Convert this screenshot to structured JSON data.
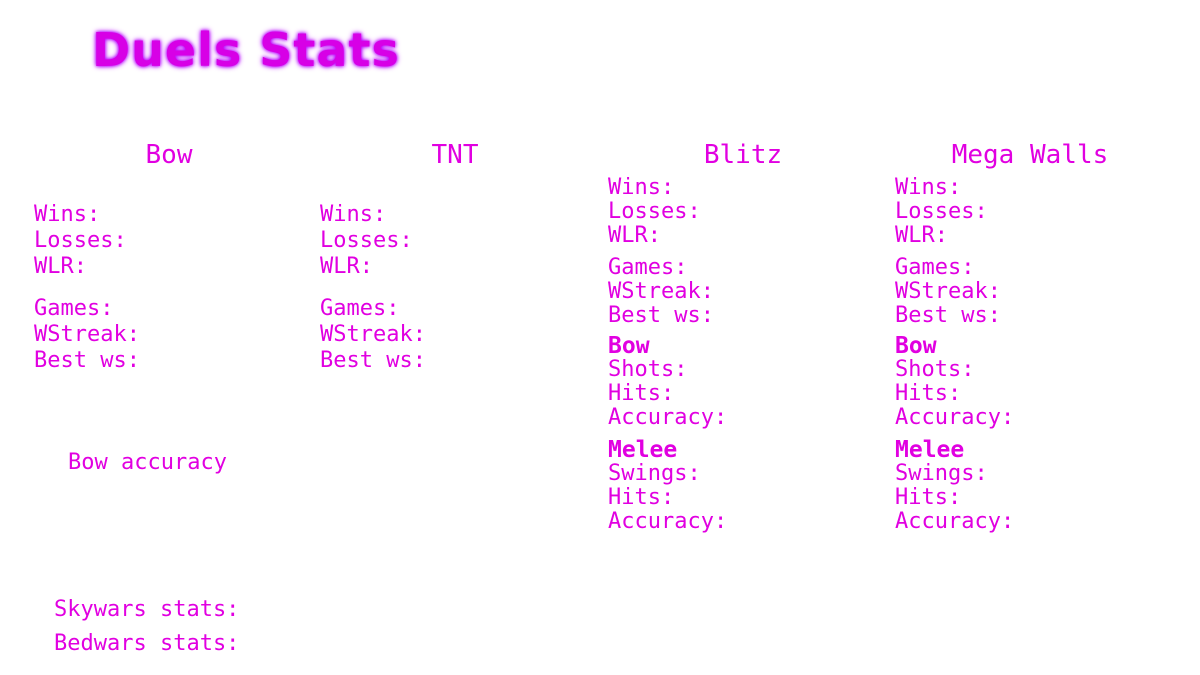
{
  "title": "Duels Stats",
  "colors": {
    "text": "#e100e1",
    "title": "#d700e6"
  },
  "columns": {
    "bow": {
      "heading": "Bow",
      "wins": "Wins:",
      "losses": "Losses:",
      "wlr": "WLR:",
      "games": "Games:",
      "wstreak": "WStreak:",
      "best_ws": "Best ws:"
    },
    "tnt": {
      "heading": "TNT",
      "wins": "Wins:",
      "losses": "Losses:",
      "wlr": "WLR:",
      "games": "Games:",
      "wstreak": "WStreak:",
      "best_ws": "Best ws:"
    },
    "blitz": {
      "heading": "Blitz",
      "wins": "Wins:",
      "losses": "Losses:",
      "wlr": "WLR:",
      "games": "Games:",
      "wstreak": "WStreak:",
      "best_ws": "Best ws:",
      "bow_heading": "Bow",
      "shots": "Shots:",
      "bow_hits": "Hits:",
      "bow_accuracy": "Accuracy:",
      "melee_heading": "Melee",
      "swings": "Swings:",
      "melee_hits": "Hits:",
      "melee_accuracy": "Accuracy:"
    },
    "megawalls": {
      "heading": "Mega Walls",
      "wins": "Wins:",
      "losses": "Losses:",
      "wlr": "WLR:",
      "games": "Games:",
      "wstreak": "WStreak:",
      "best_ws": "Best ws:",
      "bow_heading": "Bow",
      "shots": "Shots:",
      "bow_hits": "Hits:",
      "bow_accuracy": "Accuracy:",
      "melee_heading": "Melee",
      "swings": "Swings:",
      "melee_hits": "Hits:",
      "melee_accuracy": "Accuracy:"
    }
  },
  "bow_accuracy_label": "Bow accuracy",
  "skywars_label": "Skywars stats:",
  "bedwars_label": "Bedwars stats:"
}
